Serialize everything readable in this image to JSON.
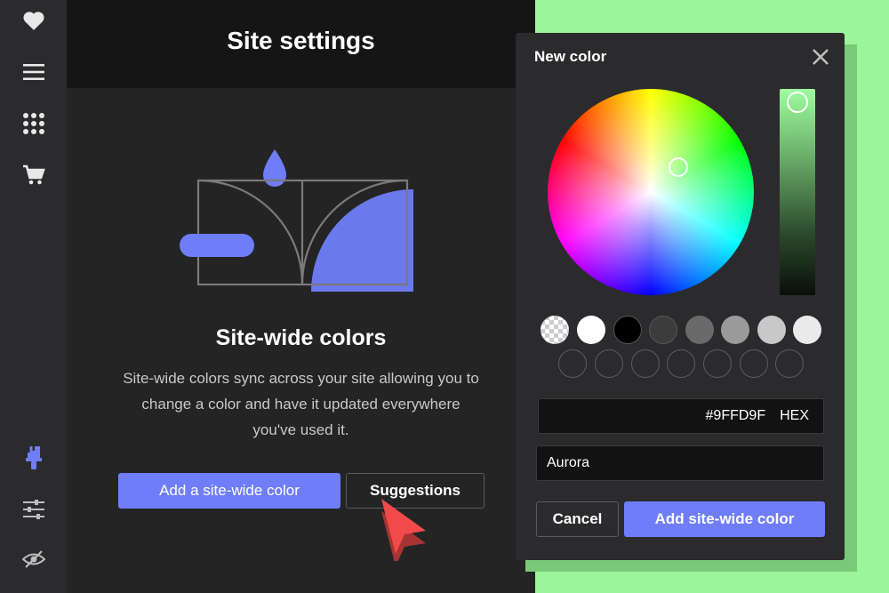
{
  "sidebar": {
    "items": [
      {
        "icon": "heart-icon"
      },
      {
        "icon": "menu-icon"
      },
      {
        "icon": "apps-grid-icon"
      },
      {
        "icon": "cart-icon"
      },
      {
        "icon": "paint-brush-icon",
        "active": true
      },
      {
        "icon": "sliders-icon"
      },
      {
        "icon": "hidden-eye-icon"
      }
    ]
  },
  "main": {
    "title": "Site settings",
    "section_title": "Site-wide colors",
    "description": "Site-wide colors sync across your site allowing you to change a color and have it updated everywhere you've used it.",
    "primary_button": "Add a site-wide color",
    "secondary_button": "Suggestions"
  },
  "dialog": {
    "title": "New color",
    "hex_value": "#9FFD9F",
    "hex_label": "HEX",
    "name_value": "Aurora",
    "cancel_label": "Cancel",
    "confirm_label": "Add site-wide color",
    "swatches": [
      "transparent",
      "#FFFFFF",
      "#000000",
      "#3C3C3C",
      "#6A6A6A",
      "#9A9A9A",
      "#C8C8C8",
      "#EAEAEA"
    ],
    "empty_swatch_count": 7
  },
  "colors": {
    "accent": "#6F7EF8",
    "selected_color": "#9FFD9F",
    "background": "#9BF59A",
    "cursor": "#F24A4A"
  }
}
